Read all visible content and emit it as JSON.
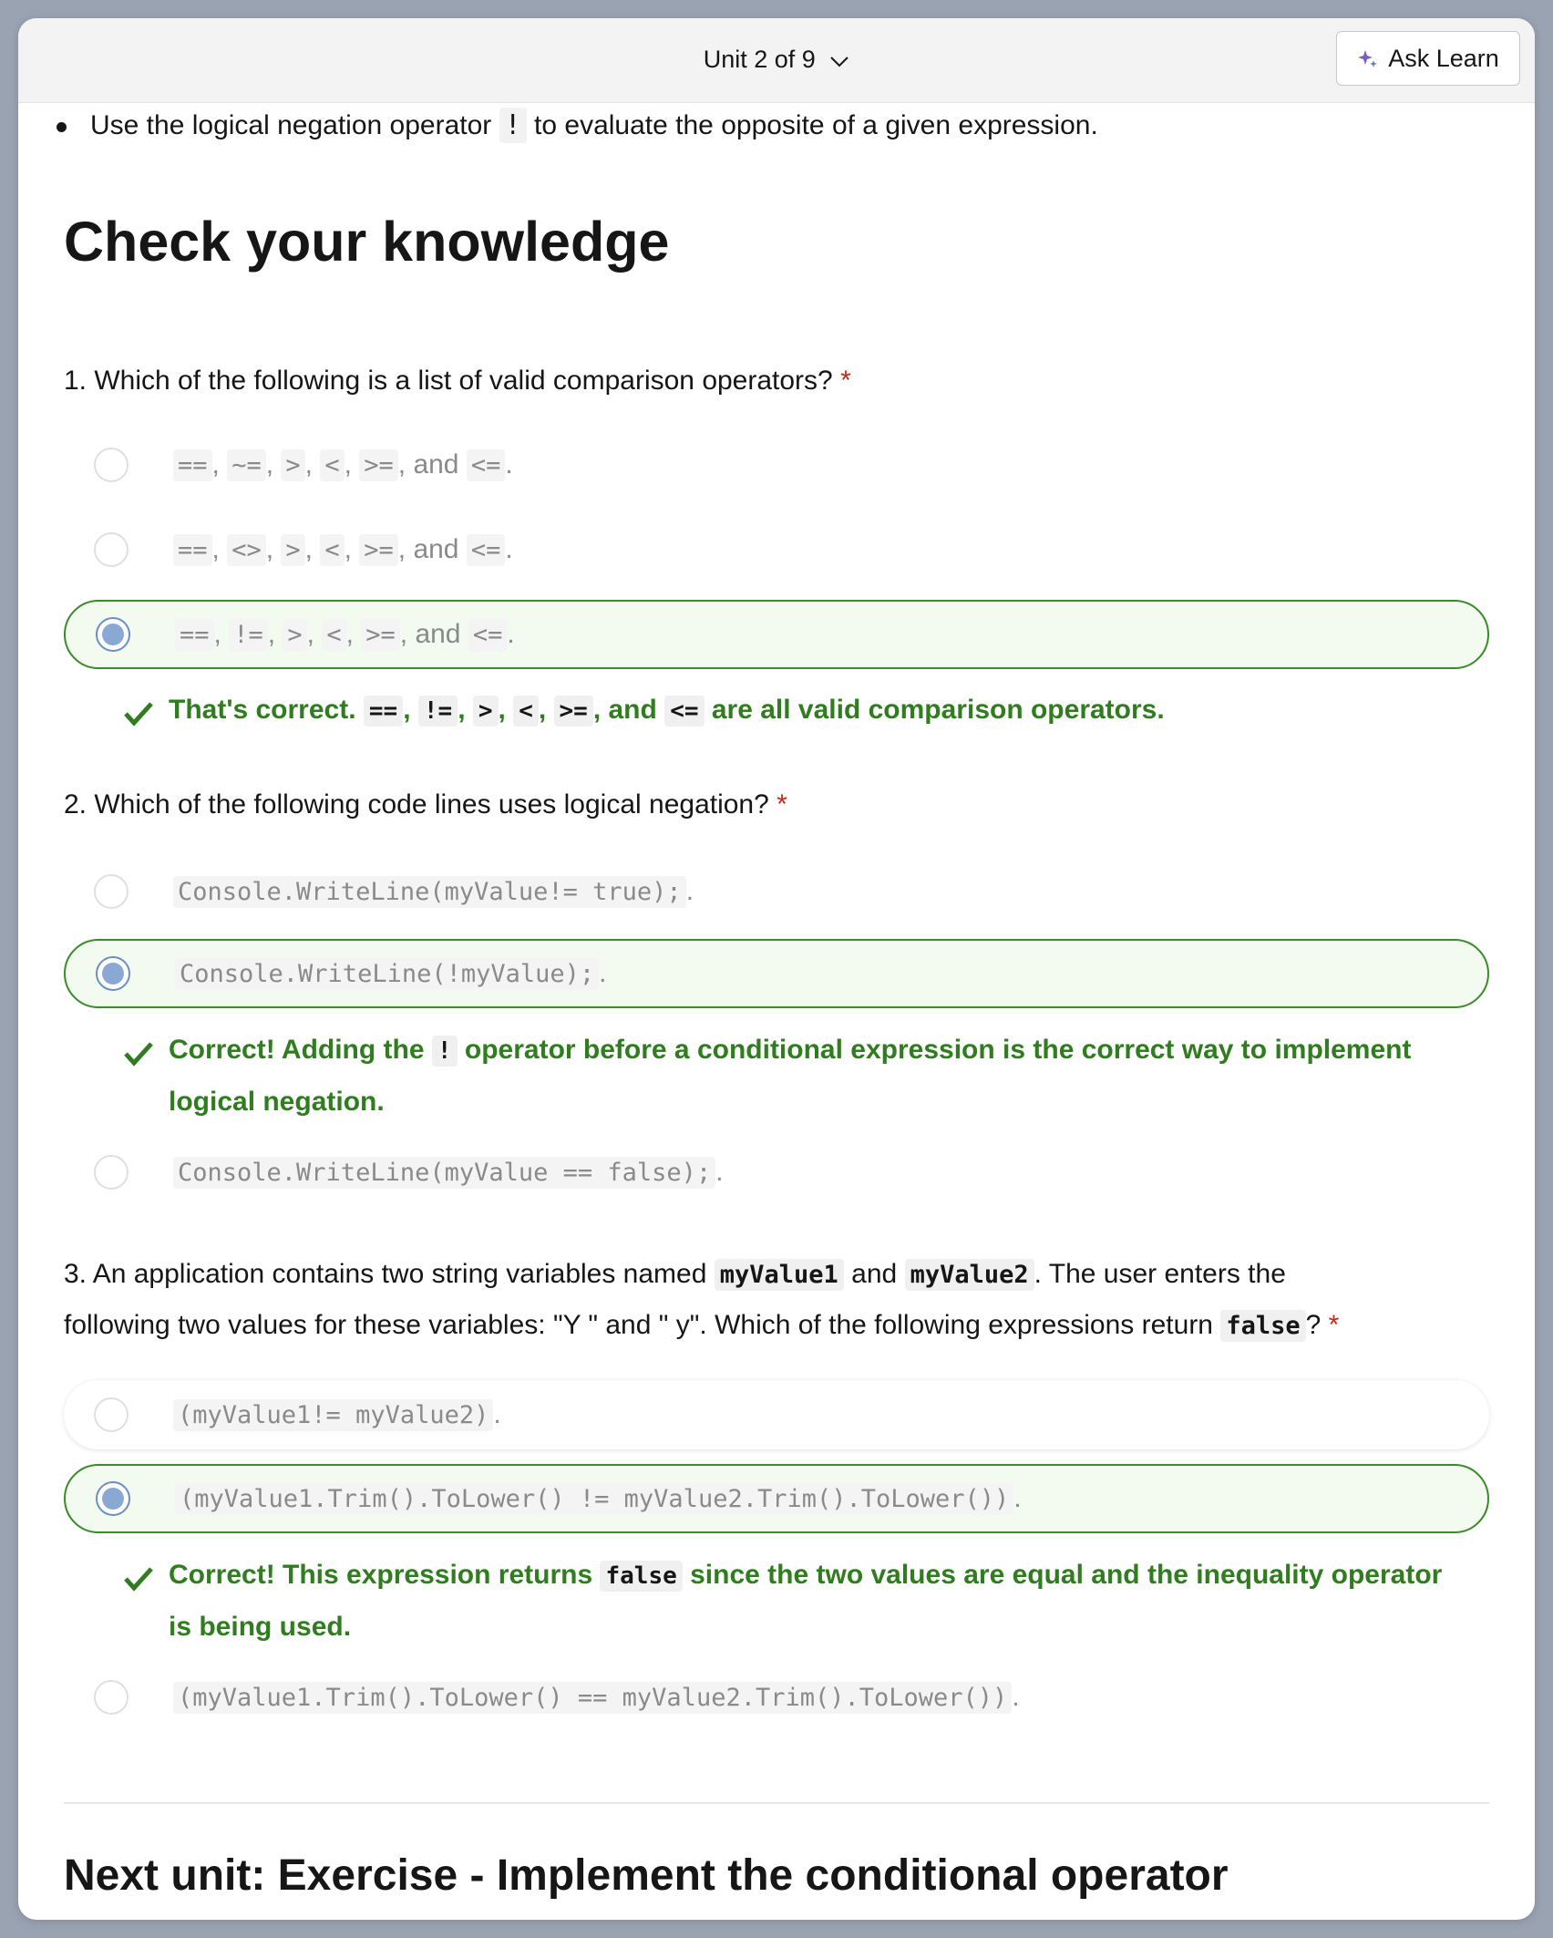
{
  "header": {
    "unit_nav_label": "Unit 2 of 9",
    "ask_learn_label": "Ask Learn"
  },
  "prev_bullet": {
    "text_before": "Use the logical negation operator",
    "code": "!",
    "text_after": "to evaluate the opposite of a given expression."
  },
  "title": "Check your knowledge",
  "q1": {
    "number_text": "1. Which of the following is a list of valid comparison operators?",
    "required": "*",
    "options": [
      {
        "ops": [
          "==",
          "~=",
          ">",
          "<",
          ">="
        ],
        "and": "and",
        "last": "<=",
        "end": "."
      },
      {
        "ops": [
          "==",
          "<>",
          ">",
          "<",
          ">="
        ],
        "and": "and",
        "last": "<=",
        "end": "."
      },
      {
        "ops": [
          "==",
          "!=",
          ">",
          "<",
          ">="
        ],
        "and": "and",
        "last": "<=",
        "end": "."
      }
    ],
    "feedback": {
      "lead": "That's correct.",
      "ops": [
        "==",
        "!=",
        ">",
        "<",
        ">="
      ],
      "and": "and",
      "last": "<=",
      "tail": "are all valid comparison operators."
    }
  },
  "q2": {
    "number_text": "2. Which of the following code lines uses logical negation?",
    "required": "*",
    "options": [
      {
        "code": "Console.WriteLine(myValue!= true);",
        "end": "."
      },
      {
        "code": "Console.WriteLine(!myValue);",
        "end": "."
      },
      {
        "code": "Console.WriteLine(myValue == false);",
        "end": "."
      }
    ],
    "feedback": {
      "before": "Correct! Adding the",
      "code": "!",
      "after_line1": "operator before a conditional expression is the correct way to implement",
      "line2": "logical negation."
    }
  },
  "q3": {
    "part1": "3. An application contains two string variables named",
    "var1": "myValue1",
    "and": "and",
    "var2": "myValue2",
    "part2": ". The user enters the",
    "line2_before": "following two values for these variables: \"Y \" and \" y\". Which of the following expressions return",
    "line2_code": "false",
    "line2_after": "?",
    "required": "*",
    "options": [
      {
        "code": "(myValue1!= myValue2)",
        "end": "."
      },
      {
        "code": "(myValue1.Trim().ToLower() != myValue2.Trim().ToLower())",
        "end": "."
      },
      {
        "code": "(myValue1.Trim().ToLower() == myValue2.Trim().ToLower())",
        "end": "."
      }
    ],
    "feedback": {
      "before": "Correct! This expression returns",
      "code": "false",
      "after_line1": "since the two values are equal and the inequality operator",
      "line2": "is being used."
    }
  },
  "next_unit": "Next unit: Exercise - Implement the conditional operator",
  "colors": {
    "correct_green": "#2f7d1f",
    "selected_border": "#3a8a2a",
    "selected_bg": "#f3faf0",
    "required_red": "#c42b1c",
    "radio_fill": "#8aa8d4"
  }
}
